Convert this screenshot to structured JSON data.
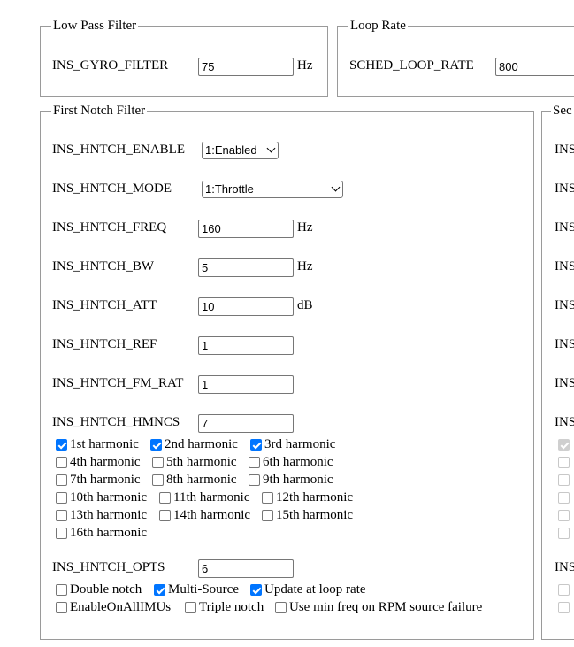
{
  "low_pass": {
    "legend": "Low Pass Filter",
    "gyro_filter_label": "INS_GYRO_FILTER",
    "gyro_filter_value": "75",
    "gyro_filter_unit": "Hz"
  },
  "loop_rate": {
    "legend": "Loop Rate",
    "sched_label": "SCHED_LOOP_RATE",
    "sched_value": "800"
  },
  "first_notch": {
    "legend": "First Notch Filter",
    "enable_label": "INS_HNTCH_ENABLE",
    "enable_value": "1:Enabled",
    "mode_label": "INS_HNTCH_MODE",
    "mode_value": "1:Throttle",
    "freq_label": "INS_HNTCH_FREQ",
    "freq_value": "160",
    "freq_unit": "Hz",
    "bw_label": "INS_HNTCH_BW",
    "bw_value": "5",
    "bw_unit": "Hz",
    "att_label": "INS_HNTCH_ATT",
    "att_value": "10",
    "att_unit": "dB",
    "ref_label": "INS_HNTCH_REF",
    "ref_value": "1",
    "fmrat_label": "INS_HNTCH_FM_RAT",
    "fmrat_value": "1",
    "hmncs_label": "INS_HNTCH_HMNCS",
    "hmncs_value": "7",
    "harmonics": [
      {
        "label": "1st harmonic",
        "checked": true
      },
      {
        "label": "2nd harmonic",
        "checked": true
      },
      {
        "label": "3rd harmonic",
        "checked": true
      },
      {
        "label": "4th harmonic",
        "checked": false
      },
      {
        "label": "5th harmonic",
        "checked": false
      },
      {
        "label": "6th harmonic",
        "checked": false
      },
      {
        "label": "7th harmonic",
        "checked": false
      },
      {
        "label": "8th harmonic",
        "checked": false
      },
      {
        "label": "9th harmonic",
        "checked": false
      },
      {
        "label": "10th harmonic",
        "checked": false
      },
      {
        "label": "11th harmonic",
        "checked": false
      },
      {
        "label": "12th harmonic",
        "checked": false
      },
      {
        "label": "13th harmonic",
        "checked": false
      },
      {
        "label": "14th harmonic",
        "checked": false
      },
      {
        "label": "15th harmonic",
        "checked": false
      },
      {
        "label": "16th harmonic",
        "checked": false
      }
    ],
    "opts_label": "INS_HNTCH_OPTS",
    "opts_value": "6",
    "options": [
      {
        "label": "Double notch",
        "checked": false
      },
      {
        "label": "Multi-Source",
        "checked": true
      },
      {
        "label": "Update at loop rate",
        "checked": true
      },
      {
        "label": "EnableOnAllIMUs",
        "checked": false
      },
      {
        "label": "Triple notch",
        "checked": false
      },
      {
        "label": "Use min freq on RPM source failure",
        "checked": false
      }
    ]
  },
  "second_notch": {
    "legend": "Sec",
    "row_label": "INS"
  }
}
